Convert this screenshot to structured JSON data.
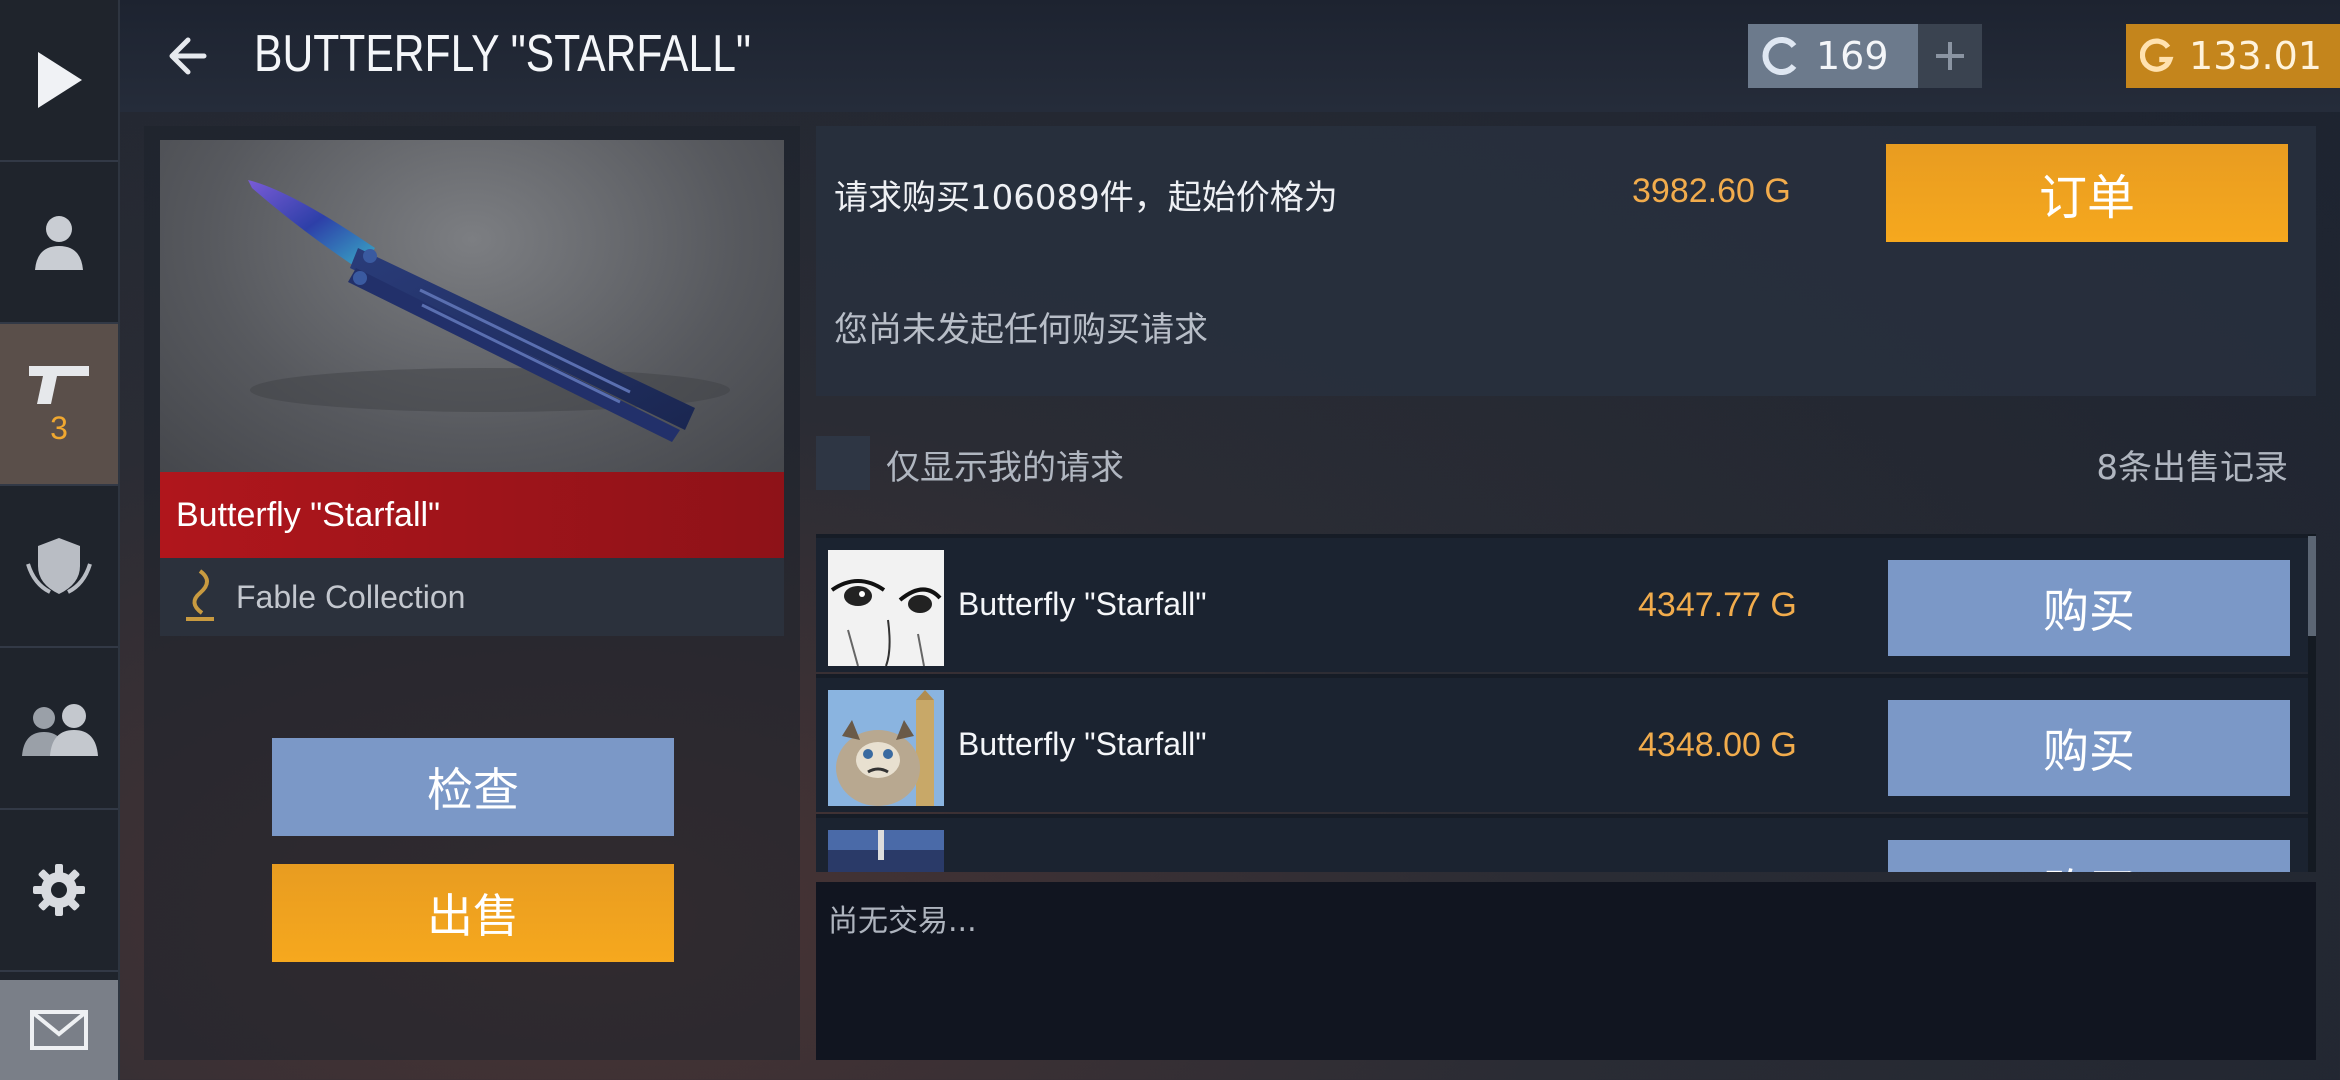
{
  "header": {
    "title": "BUTTERFLY \"STARFALL\"",
    "currency_credits": "169",
    "currency_gold": "133.01"
  },
  "sidebar": {
    "items": [
      {
        "icon": "play-icon"
      },
      {
        "icon": "profile-icon"
      },
      {
        "icon": "pistol-icon",
        "count": "3"
      },
      {
        "icon": "clan-shield-icon"
      },
      {
        "icon": "friends-icon"
      },
      {
        "icon": "gear-icon"
      },
      {
        "icon": "mail-icon"
      }
    ]
  },
  "item": {
    "name": "Butterfly \"Starfall\"",
    "collection": "Fable Collection",
    "inspect_label": "检查",
    "sell_label": "出售"
  },
  "order": {
    "request_text": "请求购买106089件，起始价格为",
    "price": "3982.60 G",
    "order_label": "订单",
    "no_requests_text": "您尚未发起任何购买请求"
  },
  "filter": {
    "label": "仅显示我的请求",
    "sales_count": "8条出售记录"
  },
  "listings": [
    {
      "name": "Butterfly \"Starfall\"",
      "price": "4347.77 G",
      "buy_label": "购买"
    },
    {
      "name": "Butterfly \"Starfall\"",
      "price": "4348.00 G",
      "buy_label": "购买"
    },
    {
      "name": "",
      "price": "",
      "buy_label": "购买"
    }
  ],
  "history": {
    "empty_text": "尚无交易..."
  },
  "colors": {
    "accent_orange": "#f6a81e",
    "button_blue": "#7b98c7",
    "price_orange": "#f2ac4c",
    "rarity_red": "#b0161c"
  }
}
